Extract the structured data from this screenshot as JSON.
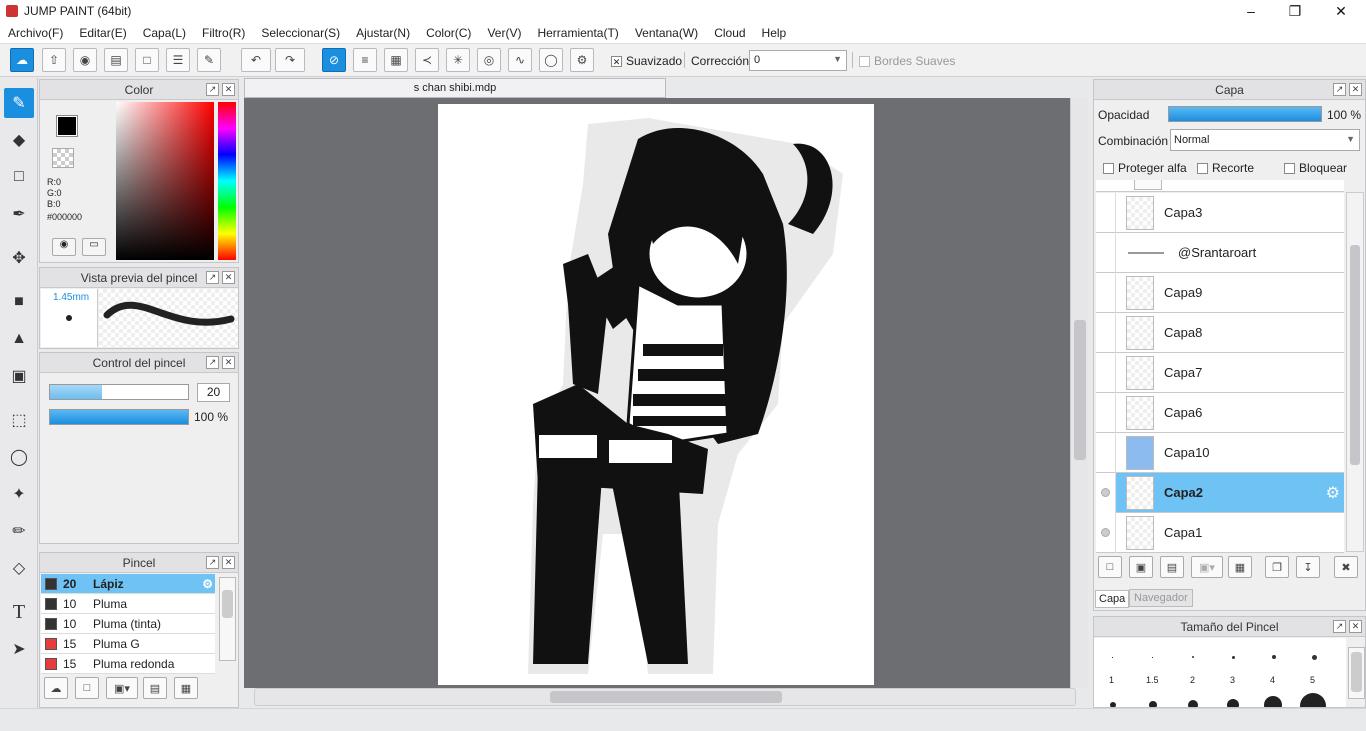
{
  "window": {
    "title": "JUMP PAINT (64bit)"
  },
  "menu": [
    "Archivo(F)",
    "Editar(E)",
    "Capa(L)",
    "Filtro(R)",
    "Seleccionar(S)",
    "Ajustar(N)",
    "Color(C)",
    "Ver(V)",
    "Herramienta(T)",
    "Ventana(W)",
    "Cloud",
    "Help"
  ],
  "toolbar": {
    "suavizado": "Suavizado",
    "correccion": "Corrección",
    "correccion_value": "0",
    "bordes": "Bordes Suaves"
  },
  "color_panel": {
    "title": "Color",
    "r": "R:0",
    "g": "G:0",
    "b": "B:0",
    "hex": "#000000",
    "fg": "#000000"
  },
  "brush_preview": {
    "title": "Vista previa del pincel",
    "size": "1.45mm"
  },
  "brush_control": {
    "title": "Control del pincel",
    "size_value": "20",
    "opacity_value": "100 %",
    "size_fraction": 0.38,
    "opacity_fraction": 1.0
  },
  "brush_panel": {
    "title": "Pincel",
    "items": [
      {
        "size": "20",
        "name": "Lápiz",
        "color": "#333333"
      },
      {
        "size": "10",
        "name": "Pluma",
        "color": "#333333"
      },
      {
        "size": "10",
        "name": "Pluma (tinta)",
        "color": "#333333"
      },
      {
        "size": "15",
        "name": "Pluma G",
        "color": "#e83c3c"
      },
      {
        "size": "15",
        "name": "Pluma redonda",
        "color": "#e83c3c"
      }
    ]
  },
  "canvas": {
    "tab": "s chan shibi.mdp"
  },
  "layer_panel": {
    "title": "Capa",
    "opacity_label": "Opacidad",
    "opacity_value": "100 %",
    "blend_label": "Combinación",
    "blend_value": "Normal",
    "protect": "Proteger alfa",
    "clip": "Recorte",
    "lock": "Bloquear",
    "layers": [
      "Capa3",
      "@Srantaroart",
      "Capa9",
      "Capa8",
      "Capa7",
      "Capa6",
      "Capa10",
      "Capa2",
      "Capa1"
    ],
    "tab_capa": "Capa",
    "tab_nav": "Navegador"
  },
  "brush_size_panel": {
    "title": "Tamaño del Pincel",
    "sizes": [
      "1",
      "1.5",
      "2",
      "3",
      "4",
      "5"
    ]
  }
}
